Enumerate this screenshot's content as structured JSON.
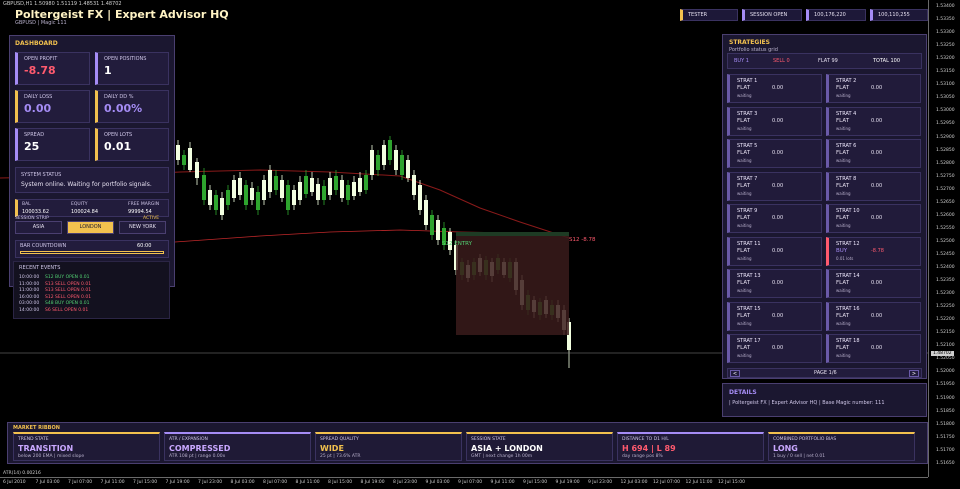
{
  "chart": {
    "info": "GBPUSD,H1  1.50980 1.51119 1.48531 1.48702",
    "price_labels": [
      "1.53400",
      "1.53350",
      "1.53300",
      "1.53250",
      "1.53200",
      "1.53150",
      "1.53100",
      "1.53050",
      "1.53000",
      "1.52950",
      "1.52900",
      "1.52850",
      "1.52800",
      "1.52750",
      "1.52700",
      "1.52650",
      "1.52600",
      "1.52550",
      "1.52500",
      "1.52450",
      "1.52400",
      "1.52350",
      "1.52300",
      "1.52250",
      "1.52200",
      "1.52150",
      "1.52100",
      "1.52050",
      "1.52000",
      "1.51950",
      "1.51900",
      "1.51850",
      "1.51800",
      "1.51750",
      "1.51700",
      "1.51650"
    ],
    "time_labels": [
      "6 Jul 2010",
      "7 Jul 03:00",
      "7 Jul 07:00",
      "7 Jul 11:00",
      "7 Jul 15:00",
      "7 Jul 19:00",
      "7 Jul 23:00",
      "8 Jul 03:00",
      "8 Jul 07:00",
      "8 Jul 11:00",
      "8 Jul 15:00",
      "8 Jul 19:00",
      "8 Jul 23:00",
      "9 Jul 03:00",
      "9 Jul 07:00",
      "9 Jul 11:00",
      "9 Jul 15:00",
      "9 Jul 19:00",
      "9 Jul 23:00",
      "12 Jul 03:00",
      "12 Jul 07:00",
      "12 Jul 11:00",
      "12 Jul 15:00"
    ],
    "trade_label": "S12 ENTRY",
    "trade_pl": "S12 -8.78",
    "current_price": "1.48702",
    "atr_label": "ATR(14) 0.00216",
    "candle_color_up": "#f2ffe0",
    "candle_color_down": "#2ea52e"
  },
  "header": {
    "title": "Poltergeist FX | Expert Advisor HQ",
    "subtitle": "GBPUSD | Magic 111",
    "tester": "TESTER",
    "session": "SESSION OPEN",
    "val1": "100,176,220",
    "val2": "100,110,255"
  },
  "dashboard": {
    "title": "DASHBOARD",
    "open_profit_label": "OPEN PROFIT",
    "open_profit": "-8.78",
    "open_positions_label": "OPEN POSITIONS",
    "open_positions": "1",
    "daily_loss_label": "DAILY LOSS",
    "daily_loss": "0.00",
    "daily_dd_label": "DAILY DD %",
    "daily_dd": "0.00%",
    "spread_label": "SPREAD",
    "spread": "25",
    "open_lots_label": "OPEN LOTS",
    "open_lots": "0.01",
    "system_status_label": "SYSTEM STATUS",
    "system_status": "System online. Waiting for portfolio signals.",
    "bal_label": "BAL",
    "bal": "100033.62",
    "equity_label": "EQUITY",
    "equity": "100024.84",
    "free_margin_label": "FREE MARGIN",
    "free_margin": "99994.54",
    "session_strip_label": "SESSION STRIP",
    "active_label": "ACTIVE",
    "sessions": [
      "ASIA",
      "LONDON",
      "NEW YORK"
    ],
    "bar_countdown_label": "BAR COUNTDOWN",
    "bar_countdown": "60:00",
    "recent_events_label": "RECENT EVENTS",
    "events": [
      {
        "time": "10:00:00",
        "text": "S12 BUY OPEN 0.01",
        "color": "#52d273"
      },
      {
        "time": "11:00:00",
        "text": "S13 SELL OPEN 0.01",
        "color": "#ff5a6e"
      },
      {
        "time": "11:00:00",
        "text": "S13 SELL OPEN 0.01",
        "color": "#ff5a6e"
      },
      {
        "time": "16:00:00",
        "text": "S12 SELL OPEN 0.01",
        "color": "#ff5a6e"
      },
      {
        "time": "03:00:00",
        "text": "S48 BUY OPEN 0.01",
        "color": "#52d273"
      },
      {
        "time": "14:00:00",
        "text": "S6 SELL OPEN 0.01",
        "color": "#ff5a6e"
      }
    ]
  },
  "strategies": {
    "title": "STRATEGIES",
    "subtitle": "Portfolio status grid",
    "buy": "BUY 1",
    "sell": "SELL 0",
    "flat": "FLAT 99",
    "total": "TOTAL 100",
    "items": [
      {
        "name": "STRAT 1",
        "state": "FLAT",
        "value": "0.00",
        "note": "waiting"
      },
      {
        "name": "STRAT 2",
        "state": "FLAT",
        "value": "0.00",
        "note": "waiting"
      },
      {
        "name": "STRAT 3",
        "state": "FLAT",
        "value": "0.00",
        "note": "waiting"
      },
      {
        "name": "STRAT 4",
        "state": "FLAT",
        "value": "0.00",
        "note": "waiting"
      },
      {
        "name": "STRAT 5",
        "state": "FLAT",
        "value": "0.00",
        "note": "waiting"
      },
      {
        "name": "STRAT 6",
        "state": "FLAT",
        "value": "0.00",
        "note": "waiting"
      },
      {
        "name": "STRAT 7",
        "state": "FLAT",
        "value": "0.00",
        "note": "waiting"
      },
      {
        "name": "STRAT 8",
        "state": "FLAT",
        "value": "0.00",
        "note": "waiting"
      },
      {
        "name": "STRAT 9",
        "state": "FLAT",
        "value": "0.00",
        "note": "waiting"
      },
      {
        "name": "STRAT 10",
        "state": "FLAT",
        "value": "0.00",
        "note": "waiting"
      },
      {
        "name": "STRAT 11",
        "state": "FLAT",
        "value": "0.00",
        "note": "waiting"
      },
      {
        "name": "STRAT 12",
        "state": "BUY",
        "value": "-8.78",
        "note": "0.01 lots",
        "active": true
      },
      {
        "name": "STRAT 13",
        "state": "FLAT",
        "value": "0.00",
        "note": "waiting"
      },
      {
        "name": "STRAT 14",
        "state": "FLAT",
        "value": "0.00",
        "note": "waiting"
      },
      {
        "name": "STRAT 15",
        "state": "FLAT",
        "value": "0.00",
        "note": "waiting"
      },
      {
        "name": "STRAT 16",
        "state": "FLAT",
        "value": "0.00",
        "note": "waiting"
      },
      {
        "name": "STRAT 17",
        "state": "FLAT",
        "value": "0.00",
        "note": "waiting"
      },
      {
        "name": "STRAT 18",
        "state": "FLAT",
        "value": "0.00",
        "note": "waiting"
      }
    ],
    "prev": "<",
    "next": ">",
    "page": "PAGE 1/6"
  },
  "details": {
    "title": "DETAILS",
    "text": "| Poltergeist FX | Expert Advisor HQ | Base Magic number: 111"
  },
  "ribbon": {
    "title": "MARKET RIBBON",
    "cards": [
      {
        "label": "TREND STATE",
        "value": "TRANSITION",
        "sub": "below 200 EMA | mixed slope",
        "color": "#c9a8ff"
      },
      {
        "label": "ATR / EXPANSION",
        "value": "COMPRESSED",
        "sub": "ATR 108 pt | range 0.00x",
        "color": "#c9a8ff"
      },
      {
        "label": "SPREAD QUALITY",
        "value": "WIDE",
        "sub": "25 pt | 73.6% ATR",
        "color": "#f2c14e"
      },
      {
        "label": "SESSION STATE",
        "value": "ASIA + LONDON",
        "sub": "GMT | next change 1h 00m",
        "color": "#ffffff"
      },
      {
        "label": "DISTANCE TO D1 H/L",
        "value": "H 694 | L 89",
        "sub": "day range pos 8%",
        "color": "#ff5a6e"
      },
      {
        "label": "COMBINED PORTFOLIO BIAS",
        "value": "LONG",
        "sub": "1 buy / 0 sell | net 0.01",
        "color": "#c9a8ff"
      }
    ]
  }
}
